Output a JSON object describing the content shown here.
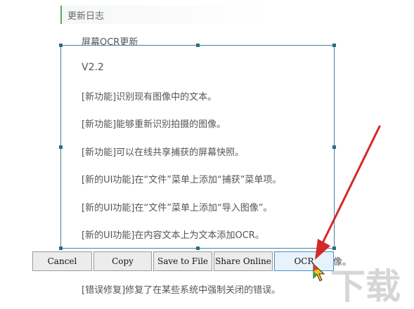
{
  "section": {
    "title": "更新日志"
  },
  "content": {
    "heading": "屏幕OCR更新",
    "version": "V2.2",
    "lines": [
      "[新功能]识别现有图像中的文本。",
      "[新功能]能够重新识别拍摄的图像。",
      "[新功能]可以在线共享捕获的屏幕快照。",
      "[新的UI功能]在“文件”菜单上添加“捕获”菜单项。",
      "[新的UI功能]在“文件”菜单上添加“导入图像”。",
      "[新的UI功能]在内容文本上为文本添加OCR。"
    ],
    "partial_tail": "像。",
    "bugfix": "[错误修复]修复了在某些系统中强制关闭的错误。"
  },
  "toolbar": {
    "cancel_label": "Cancel",
    "copy_label": "Copy",
    "save_label": "Save to File",
    "share_label": "Share Online",
    "ocr_label": "OCR"
  },
  "watermark": {
    "logo_text": "下载"
  },
  "colors": {
    "accent_green": "#55aa66",
    "selection_border": "#4a7f9a",
    "arrow_red": "#d42828",
    "active_button_border": "#3e8fd0"
  },
  "icons": [
    "mouse-pointer-icon",
    "red-arrow-annotation"
  ]
}
